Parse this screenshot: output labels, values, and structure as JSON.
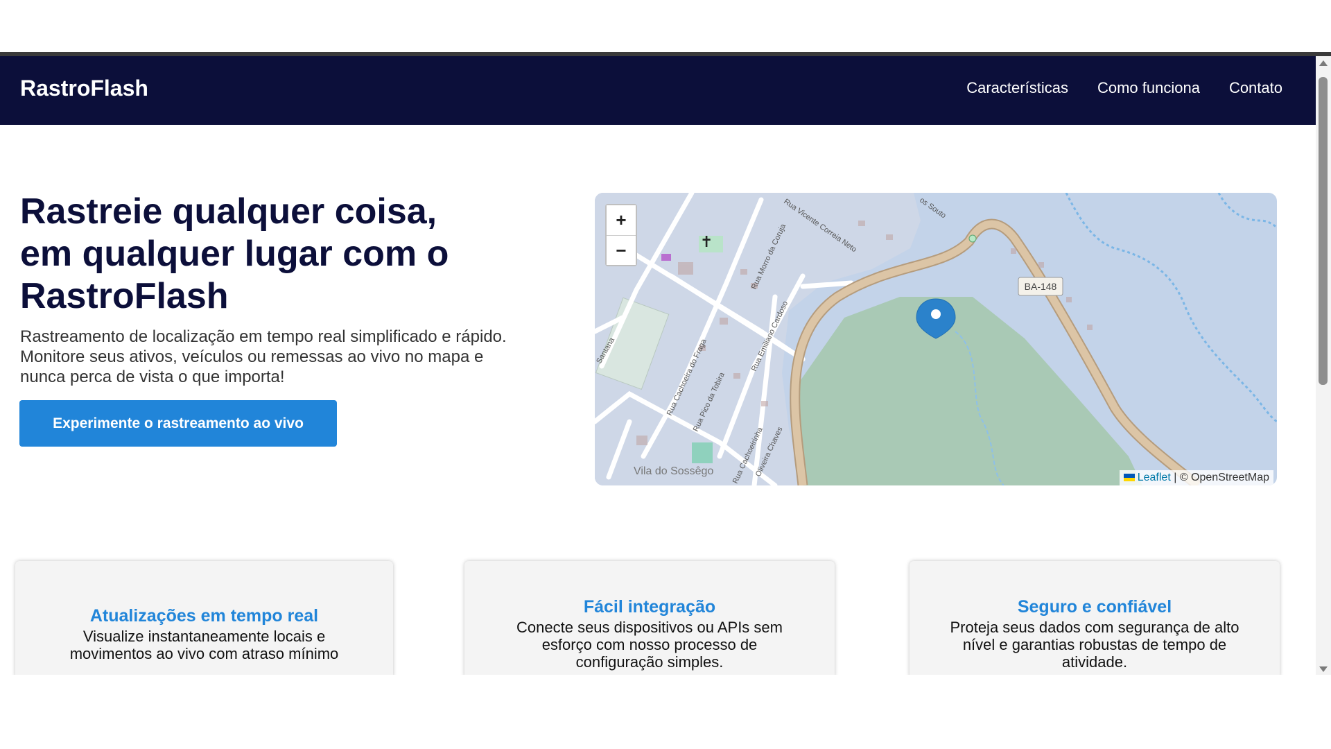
{
  "nav": {
    "brand": "RastroFlash",
    "links": [
      "Características",
      "Como funciona",
      "Contato"
    ]
  },
  "hero": {
    "title": "Rastreie qualquer coisa, em qualquer lugar com o RastroFlash",
    "subtitle": "Rastreamento de localização em tempo real simplificado e rápido. Monitore seus ativos, veículos ou remessas ao vivo no mapa e nunca perca de vista o que importa!",
    "cta": "Experimente o rastreamento ao vivo"
  },
  "map": {
    "zoom_in": "+",
    "zoom_out": "−",
    "attribution_link": "Leaflet",
    "attribution_rest": " | © OpenStreetMap",
    "road_shield": "BA-148",
    "place_label": "Vila do Sossêgo",
    "street_labels": [
      "Rua Vicente Correia Neto",
      "Rua Morro da Coruja",
      "Rua Emiliano Cardoso",
      "Rua Cachoeira do Fraga",
      "Rua Pico da Tobira",
      "Rua Cachoeirinha",
      "Oliveira Chaves",
      "Santana",
      "os Souto"
    ],
    "marker_icon": "map-marker-icon",
    "colors": {
      "forest": "#a9c9b5",
      "road": "#d9c3a3",
      "water": "#c3d3e9",
      "marker": "#2b82cb"
    }
  },
  "features": [
    {
      "title": "Atualizações em tempo real",
      "text": "Visualize instantaneamente locais e movimentos ao vivo com atraso mínimo"
    },
    {
      "title": "Fácil integração",
      "text": "Conecte seus dispositivos ou APIs sem esforço com nosso processo de configuração simples."
    },
    {
      "title": "Seguro e confiável",
      "text": "Proteja seus dados com segurança de alto nível e garantias robustas de tempo de atividade."
    }
  ],
  "colors": {
    "navbar": "#0c0f3a",
    "accent": "#2185d9",
    "card_bg": "#f4f4f4"
  }
}
